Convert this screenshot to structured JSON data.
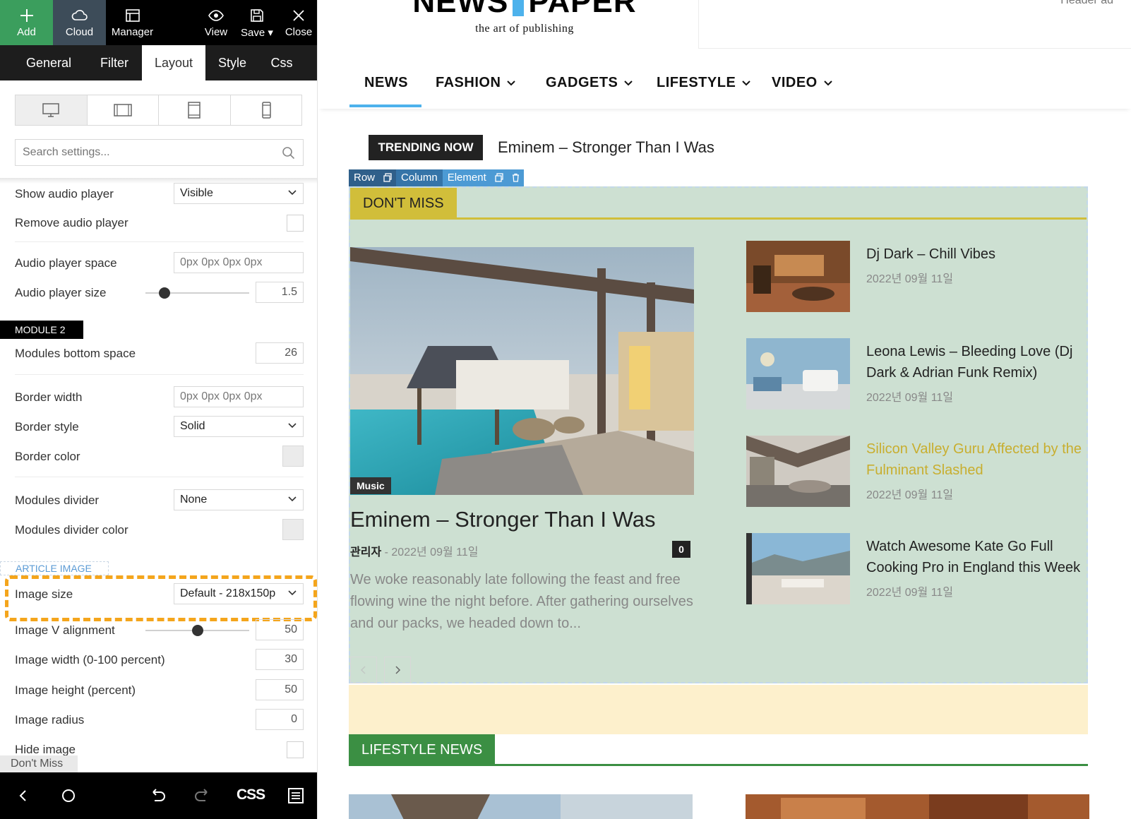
{
  "toolbar": {
    "add": "Add",
    "cloud": "Cloud",
    "manager": "Manager",
    "view": "View",
    "save": "Save",
    "close": "Close"
  },
  "tabs": [
    {
      "label": "General"
    },
    {
      "label": "Filter"
    },
    {
      "label": "Layout",
      "active": true
    },
    {
      "label": "Style"
    },
    {
      "label": "Css"
    }
  ],
  "devices": [
    "desktop-icon",
    "landscape-tablet-icon",
    "portrait-tablet-icon",
    "phone-icon"
  ],
  "search": {
    "placeholder": "Search settings..."
  },
  "settings": {
    "show_audio_player": {
      "label": "Show audio player",
      "value": "Visible"
    },
    "remove_audio_player": {
      "label": "Remove audio player"
    },
    "audio_player_space": {
      "label": "Audio player space",
      "placeholder": "0px 0px 0px 0px"
    },
    "audio_player_size": {
      "label": "Audio player size",
      "value": "1.5"
    },
    "module2_header": "MODULE 2",
    "modules_bottom_space": {
      "label": "Modules bottom space",
      "value": "26"
    },
    "border_width": {
      "label": "Border width",
      "placeholder": "0px 0px 0px 0px"
    },
    "border_style": {
      "label": "Border style",
      "value": "Solid"
    },
    "border_color": {
      "label": "Border color"
    },
    "modules_divider": {
      "label": "Modules divider",
      "value": "None"
    },
    "modules_divider_color": {
      "label": "Modules divider color"
    },
    "article_image_header": "ARTICLE IMAGE",
    "image_size": {
      "label": "Image size",
      "value": "Default - 218x150p"
    },
    "image_v_alignment": {
      "label": "Image V alignment",
      "value": "50"
    },
    "image_width": {
      "label": "Image width (0-100 percent)",
      "value": "30"
    },
    "image_height": {
      "label": "Image height (percent)",
      "value": "50"
    },
    "image_radius": {
      "label": "Image radius",
      "value": "0"
    },
    "hide_image": {
      "label": "Hide image"
    }
  },
  "breadcrumb": "Don't Miss",
  "bottom_bar": {
    "css_label": "CSS"
  },
  "preview": {
    "logo_left": "NEWS",
    "logo_right": "PAPER",
    "tagline": "the art of publishing",
    "header_ad": "Header ad",
    "nav": [
      {
        "label": "NEWS",
        "active": true
      },
      {
        "label": "FASHION",
        "dropdown": true
      },
      {
        "label": "GADGETS",
        "dropdown": true
      },
      {
        "label": "LIFESTYLE",
        "dropdown": true
      },
      {
        "label": "VIDEO",
        "dropdown": true
      }
    ],
    "trending_badge": "TRENDING NOW",
    "trending_text": "Eminem – Stronger Than I Was",
    "controls": {
      "row": "Row",
      "column": "Column",
      "element": "Element"
    },
    "dont_miss": "DON'T MISS",
    "main_article": {
      "category": "Music",
      "title": "Eminem – Stronger Than I Was",
      "author": "관리자",
      "separator": "-",
      "date": "2022년 09월 11일",
      "comments": "0",
      "excerpt": "We woke reasonably late following the feast and free flowing wine the night before. After gathering ourselves and our packs, we headed down to..."
    },
    "side_articles": [
      {
        "title": "Dj Dark – Chill Vibes",
        "date": "2022년 09월 11일"
      },
      {
        "title": "Leona Lewis – Bleeding Love (Dj Dark & Adrian Funk Remix)",
        "date": "2022년 09월 11일"
      },
      {
        "title": "Silicon Valley Guru Affected by the Fulminant Slashed",
        "date": "2022년 09월 11일",
        "highlighted": true
      },
      {
        "title": "Watch Awesome Kate Go Full Cooking Pro in England this Week",
        "date": "2022년 09월 11일"
      }
    ],
    "lifestyle_news": "LIFESTYLE NEWS"
  },
  "colors": {
    "add_green": "#3b9e5d",
    "cloud_slate": "#3d4c59",
    "accent_blue": "#4db2ec",
    "dont_miss_gold": "#d1be3a",
    "block_bg": "#cde0d2",
    "lifestyle_green": "#3b8f43",
    "highlight_orange": "#f4a51c",
    "hover_title": "#c8ae2f"
  }
}
